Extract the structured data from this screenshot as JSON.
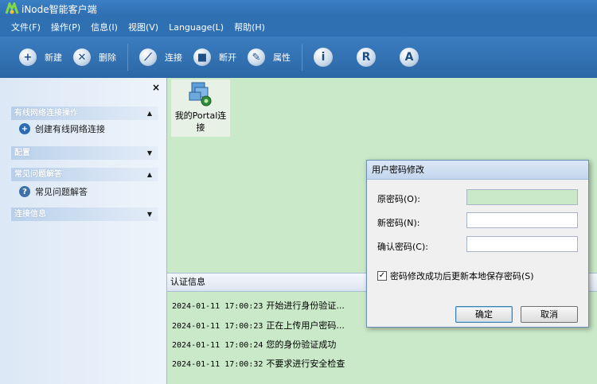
{
  "window": {
    "title": "iNode智能客户端"
  },
  "menu": [
    {
      "label": "文件(F)"
    },
    {
      "label": "操作(P)"
    },
    {
      "label": "信息(I)"
    },
    {
      "label": "视图(V)"
    },
    {
      "label": "Language(L)"
    },
    {
      "label": "帮助(H)"
    }
  ],
  "toolbar": {
    "new_label": "新建",
    "delete_label": "删除",
    "connect_label": "连接",
    "disconnect_label": "断开",
    "properties_label": "属性",
    "info_glyph": "i",
    "r_glyph": "R",
    "a_glyph": "A"
  },
  "sidebar": {
    "close": "×",
    "panels": [
      {
        "header": "有线网络连接操作",
        "arrow": "▲",
        "item": "创建有线网络连接",
        "item_icon": "add-circle-icon"
      },
      {
        "header": "配置",
        "arrow": "▼"
      },
      {
        "header": "常见问题解答",
        "arrow": "▲",
        "item": "常见问题解答",
        "item_icon": "help-circle-icon"
      },
      {
        "header": "连接信息",
        "arrow": "▼"
      }
    ]
  },
  "connection": {
    "label": "我的Portal连接"
  },
  "auth": {
    "header": "认证信息",
    "log": [
      {
        "time": "2024-01-11 17:00:23",
        "message": "开始进行身份验证..."
      },
      {
        "time": "2024-01-11 17:00:23",
        "message": "正在上传用户密码..."
      },
      {
        "time": "2024-01-11 17:00:24",
        "message": "您的身份验证成功"
      },
      {
        "time": "2024-01-11 17:00:32",
        "message": "不要求进行安全检查"
      }
    ]
  },
  "dialog": {
    "title": "用户密码修改",
    "old_password_label": "原密码(O):",
    "new_password_label": "新密码(N):",
    "confirm_password_label": "确认密码(C):",
    "old_password_value": "",
    "new_password_value": "",
    "confirm_password_value": "",
    "save_checkbox_label": "密码修改成功后更新本地保存密码(S)",
    "save_checkbox_checked": true,
    "ok_label": "确定",
    "cancel_label": "取消"
  },
  "colors": {
    "titlebar": "#2e6db0",
    "workspace": "#c9e9c8",
    "sidebar": "#dce8f6"
  }
}
